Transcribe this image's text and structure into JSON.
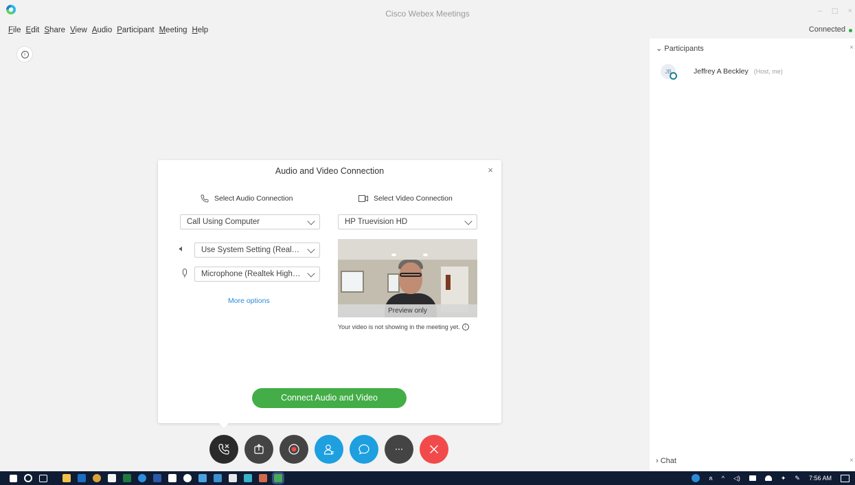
{
  "window": {
    "title": "Cisco Webex Meetings",
    "connection_status": "Connected",
    "status_color": "#2cae3e"
  },
  "menu": [
    "File",
    "Edit",
    "Share",
    "View",
    "Audio",
    "Participant",
    "Meeting",
    "Help"
  ],
  "dialog": {
    "title": "Audio and Video Connection",
    "close_label": "×",
    "audio": {
      "heading": "Select Audio Connection",
      "connection": "Call Using Computer",
      "speaker": "Use System Setting (Realtek ...",
      "microphone": "Microphone (Realtek High D...",
      "more_options": "More options"
    },
    "video": {
      "heading": "Select Video Connection",
      "camera": "HP Truevision HD",
      "preview_caption": "Preview only",
      "note": "Your video is not showing in the meeting yet."
    },
    "connect_button": "Connect Audio and Video",
    "accent_color": "#43ad47",
    "link_color": "#2b8ad8"
  },
  "controls": [
    {
      "name": "audio-button",
      "icon": "phone-icon",
      "color": "#2a2a2a"
    },
    {
      "name": "share-button",
      "icon": "share-icon",
      "color": "#444444"
    },
    {
      "name": "record-button",
      "icon": "record-icon",
      "color": "#444444"
    },
    {
      "name": "participants-button",
      "icon": "participants-icon",
      "color": "#1d9fe0"
    },
    {
      "name": "chat-button",
      "icon": "chat-icon",
      "color": "#1d9fe0"
    },
    {
      "name": "more-button",
      "icon": "more-icon",
      "color": "#444444"
    },
    {
      "name": "leave-button",
      "icon": "close-icon",
      "color": "#f24a4a"
    }
  ],
  "participants_panel": {
    "heading": "Participants",
    "participants": [
      {
        "initials": "JB",
        "name": "Jeffrey A Beckley",
        "role": "(Host, me)"
      }
    ],
    "chat_heading": "Chat"
  },
  "taskbar": {
    "time": "7:56 AM"
  }
}
